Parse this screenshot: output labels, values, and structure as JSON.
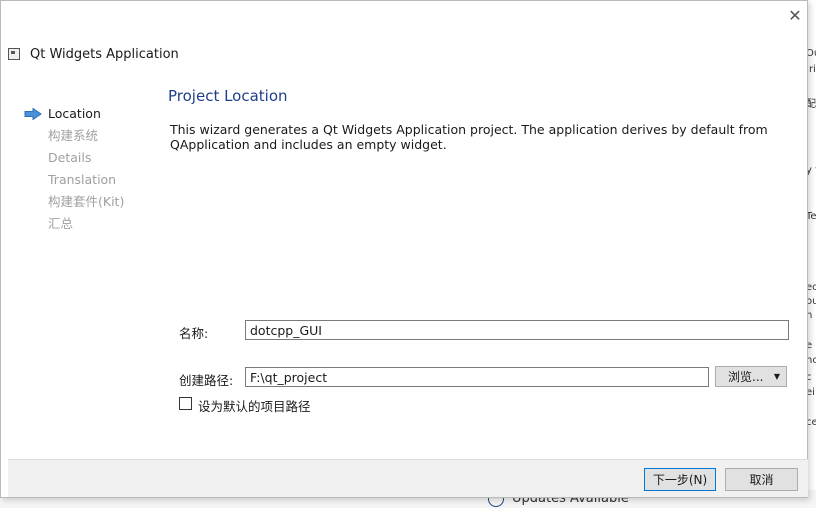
{
  "dialog": {
    "title": "Qt Widgets Application",
    "close_glyph": "✕"
  },
  "steps": [
    {
      "label": "Location",
      "active": true
    },
    {
      "label": "构建系统",
      "active": false
    },
    {
      "label": "Details",
      "active": false
    },
    {
      "label": "Translation",
      "active": false
    },
    {
      "label": "构建套件(Kit)",
      "active": false
    },
    {
      "label": "汇总",
      "active": false
    }
  ],
  "page": {
    "title": "Project Location",
    "description_line1": "This wizard generates a Qt Widgets Application project. The application derives by default from",
    "description_line2": "QApplication and includes an empty widget."
  },
  "form": {
    "name_label": "名称:",
    "name_value": "dotcpp_GUI",
    "path_label": "创建路径:",
    "path_value": "F:\\qt_project",
    "browse_label": "浏览...",
    "default_path_label": "设为默认的项目路径",
    "default_path_checked": false
  },
  "footer": {
    "next_label": "下一步(N)",
    "cancel_label": "取消"
  },
  "background": {
    "bottom_text": "Updates Available",
    "right_fragments": [
      "Ou",
      "Iri",
      "配",
      "y f",
      "Te",
      "ec",
      "ou",
      "n",
      "e",
      "nc",
      "c",
      "ei",
      "ce"
    ]
  },
  "colors": {
    "accent": "#1f3f8a",
    "primary_border": "#0078d7",
    "disabled_text": "#a0a0a0"
  }
}
